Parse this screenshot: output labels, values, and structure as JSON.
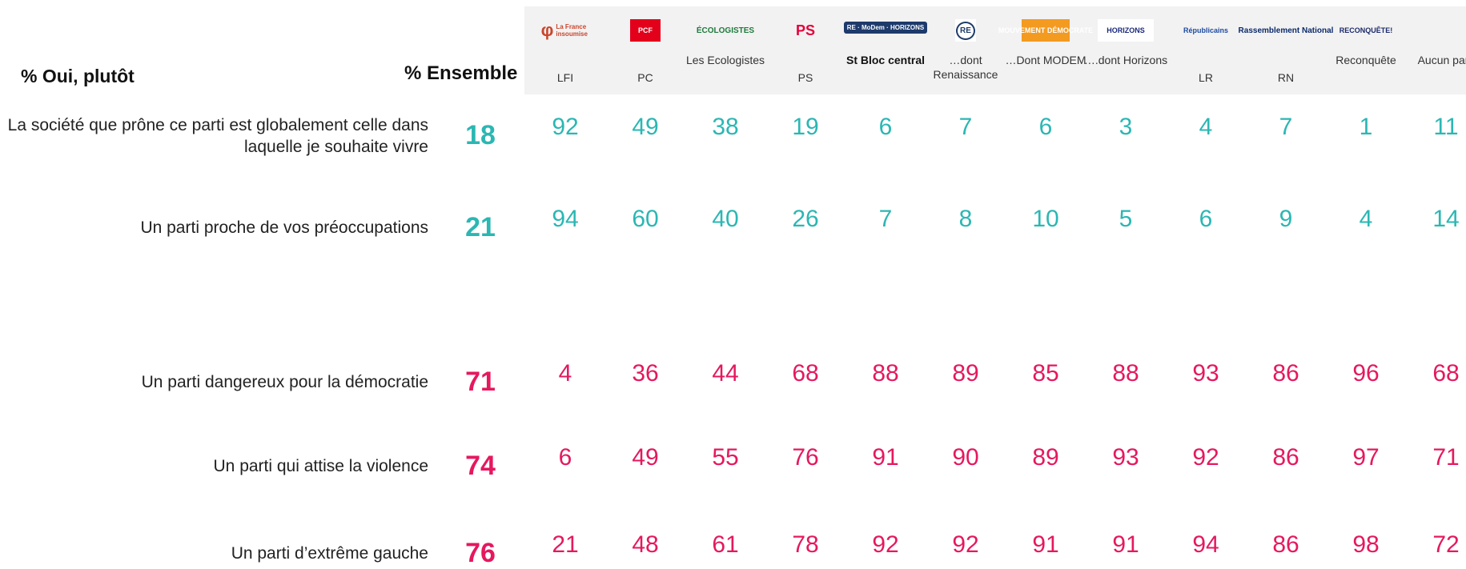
{
  "header": {
    "row_title": "% Oui, plutôt",
    "ensemble_title": "% Ensemble"
  },
  "colors": {
    "positive": "#2bb7b3",
    "negative": "#e5185f",
    "header_band": "#f2f2f2"
  },
  "columns": [
    {
      "label": "LFI",
      "logo_text": "La France insoumise",
      "logo_icon": "lfi-phi-logo-icon"
    },
    {
      "label": "PC",
      "logo_text": "PCF",
      "logo_icon": "pcf-star-logo-icon"
    },
    {
      "label": "Les Ecologistes",
      "logo_text": "ÉCOLOGISTES",
      "logo_icon": "ecologistes-logo-icon"
    },
    {
      "label": "PS",
      "logo_text": "PS",
      "logo_icon": "ps-rose-logo-icon"
    },
    {
      "label": "St Bloc central",
      "logo_text": "RE · MoDem · HORIZONS",
      "logo_icon": "bloc-central-logos-icon"
    },
    {
      "label": "…dont Renaissance",
      "logo_text": "RE",
      "logo_icon": "renaissance-logo-icon"
    },
    {
      "label": "…Dont MODEM",
      "logo_text": "MOUVEMENT DÉMOCRATE",
      "logo_icon": "modem-logo-icon"
    },
    {
      "label": "….dont Horizons",
      "logo_text": "HORIZONS",
      "logo_icon": "horizons-logo-icon"
    },
    {
      "label": "LR",
      "logo_text": "Républicains",
      "logo_icon": "lr-logo-icon"
    },
    {
      "label": "RN",
      "logo_text": "Rassemblement National",
      "logo_icon": "rn-flame-logo-icon"
    },
    {
      "label": "Reconquête",
      "logo_text": "RECONQUÊTE!",
      "logo_icon": "reconquete-logo-icon"
    },
    {
      "label": "Aucun parti",
      "logo_text": "",
      "logo_icon": ""
    }
  ],
  "chart_data": {
    "type": "table",
    "columns": [
      "LFI",
      "PC",
      "Les Ecologistes",
      "PS",
      "St Bloc central",
      "…dont Renaissance",
      "…Dont MODEM",
      "….dont Horizons",
      "LR",
      "RN",
      "Reconquête",
      "Aucun parti"
    ],
    "rows": [
      {
        "label": "La société que prône ce parti est globalement celle dans laquelle je souhaite vivre",
        "ensemble": 18,
        "values": [
          92,
          49,
          38,
          19,
          6,
          7,
          6,
          3,
          4,
          7,
          1,
          11
        ],
        "tone": "positive"
      },
      {
        "label": "Un parti proche de vos préoccupations",
        "ensemble": 21,
        "values": [
          94,
          60,
          40,
          26,
          7,
          8,
          10,
          5,
          6,
          9,
          4,
          14
        ],
        "tone": "positive"
      },
      {
        "label": "Un parti dangereux pour la démocratie",
        "ensemble": 71,
        "values": [
          4,
          36,
          44,
          68,
          88,
          89,
          85,
          88,
          93,
          86,
          96,
          68
        ],
        "tone": "negative"
      },
      {
        "label": "Un parti qui attise la violence",
        "ensemble": 74,
        "values": [
          6,
          49,
          55,
          76,
          91,
          90,
          89,
          93,
          92,
          86,
          97,
          71
        ],
        "tone": "negative"
      },
      {
        "label": "Un parti d’extrême gauche",
        "ensemble": 76,
        "values": [
          21,
          48,
          61,
          78,
          92,
          92,
          91,
          91,
          94,
          86,
          98,
          72
        ],
        "tone": "negative"
      }
    ]
  }
}
